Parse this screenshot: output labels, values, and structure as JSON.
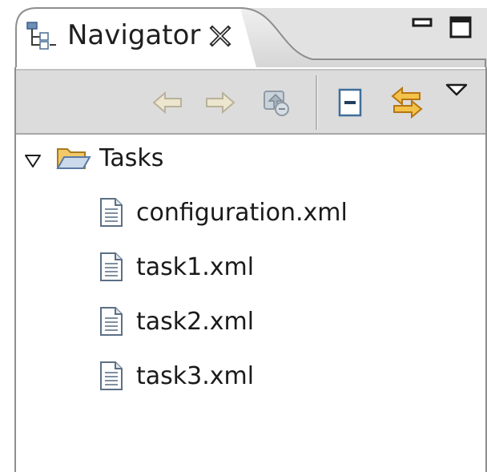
{
  "view": {
    "tab": {
      "title": "Navigator",
      "icon": "navigator-icon",
      "close_icon": "close-icon"
    },
    "window_controls": [
      "minimize-icon",
      "maximize-icon"
    ]
  },
  "toolbar": {
    "buttons": [
      {
        "icon": "back-arrow-icon",
        "enabled": false
      },
      {
        "icon": "forward-arrow-icon",
        "enabled": false
      },
      {
        "icon": "up-folder-icon",
        "enabled": false
      },
      {
        "icon": "collapse-all-icon",
        "enabled": true
      },
      {
        "icon": "link-with-editor-icon",
        "enabled": true
      },
      {
        "icon": "view-menu-icon",
        "enabled": true
      }
    ]
  },
  "tree": {
    "root": {
      "label": "Tasks",
      "icon": "open-folder-icon",
      "expanded": true
    },
    "children": [
      {
        "label": "configuration.xml",
        "icon": "file-icon"
      },
      {
        "label": "task1.xml",
        "icon": "file-icon"
      },
      {
        "label": "task2.xml",
        "icon": "file-icon"
      },
      {
        "label": "task3.xml",
        "icon": "file-icon"
      }
    ]
  },
  "colors": {
    "toolbar_bg": "#dcdcdc",
    "tab_strip_bg": "#e2e2e2",
    "frame": "#8e8e8e",
    "folder": "#d9a334",
    "link_icon": "#d38b16",
    "text": "#1a1a1a"
  }
}
